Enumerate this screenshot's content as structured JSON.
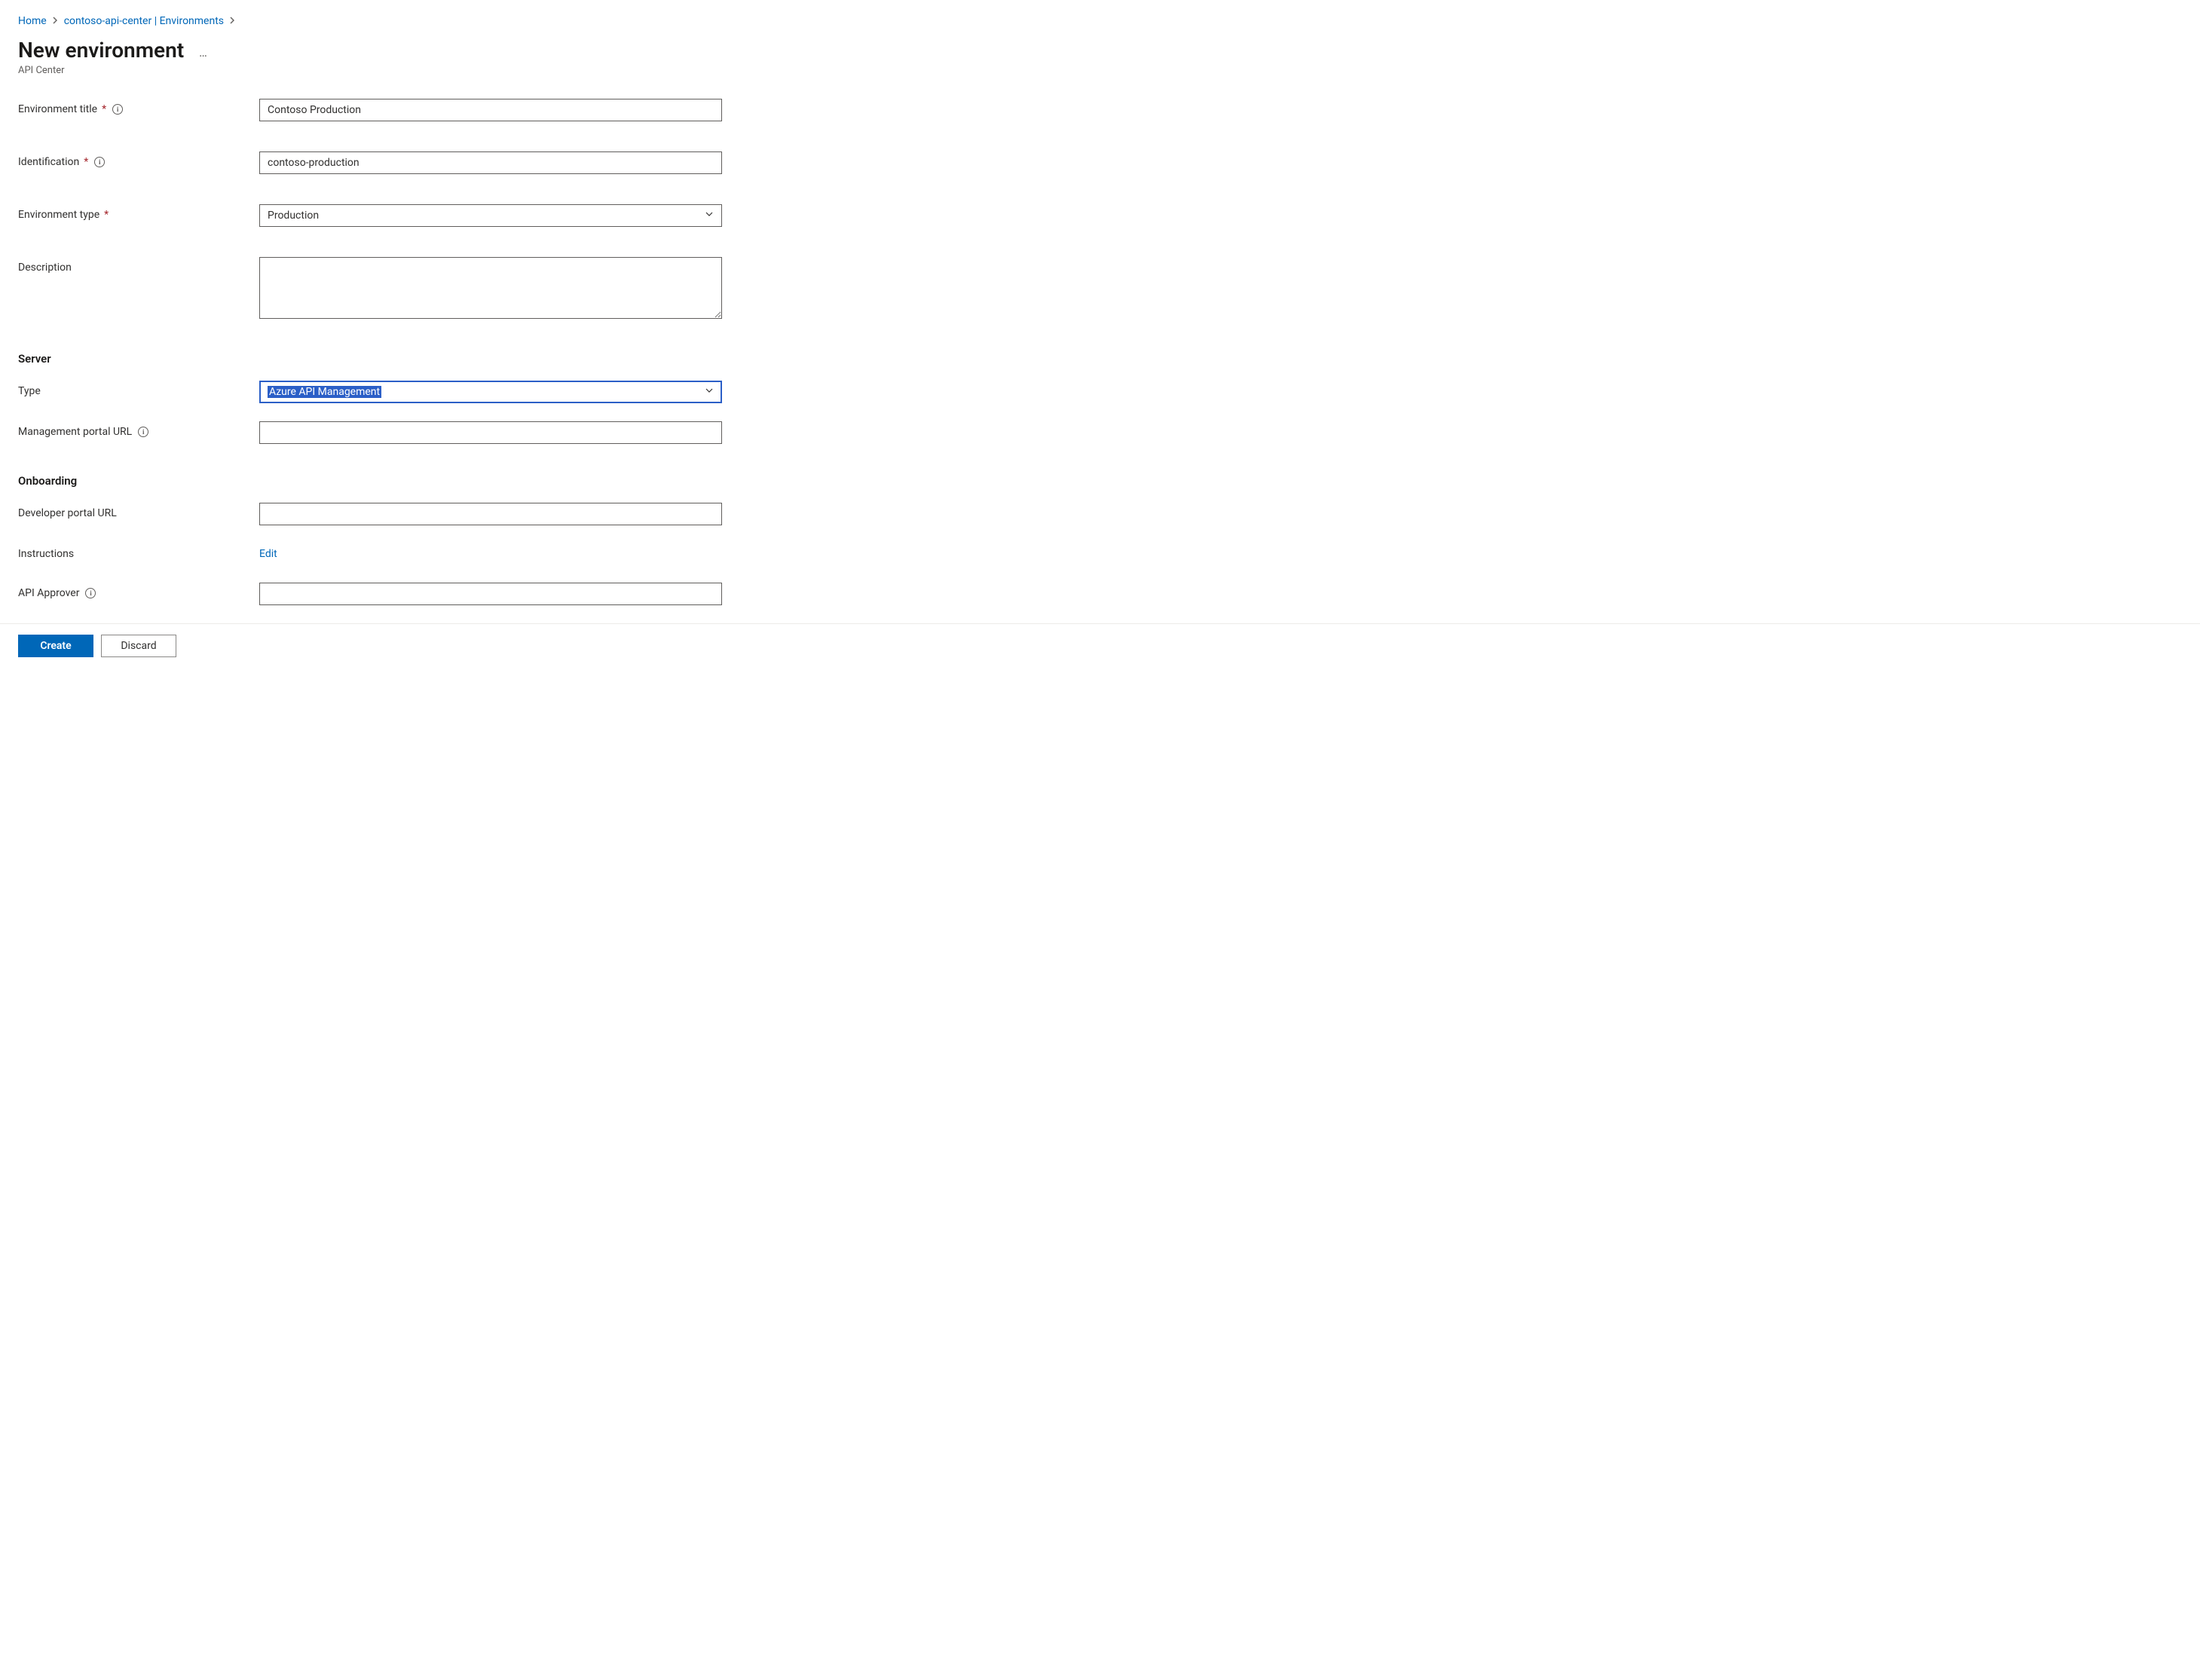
{
  "breadcrumb": {
    "home": "Home",
    "resource": "contoso-api-center | Environments"
  },
  "header": {
    "title": "New environment",
    "subtitle": "API Center",
    "more": "…"
  },
  "form": {
    "env_title": {
      "label": "Environment title",
      "value": "Contoso Production"
    },
    "identification": {
      "label": "Identification",
      "value": "contoso-production"
    },
    "env_type": {
      "label": "Environment type",
      "value": "Production"
    },
    "description": {
      "label": "Description",
      "value": ""
    }
  },
  "server": {
    "heading": "Server",
    "type": {
      "label": "Type",
      "value": "Azure API Management"
    },
    "mgmt_url": {
      "label": "Management portal URL",
      "value": ""
    }
  },
  "onboarding": {
    "heading": "Onboarding",
    "dev_url": {
      "label": "Developer portal URL",
      "value": ""
    },
    "instructions": {
      "label": "Instructions",
      "action": "Edit"
    },
    "approver": {
      "label": "API Approver",
      "value": ""
    }
  },
  "footer": {
    "create": "Create",
    "discard": "Discard"
  }
}
